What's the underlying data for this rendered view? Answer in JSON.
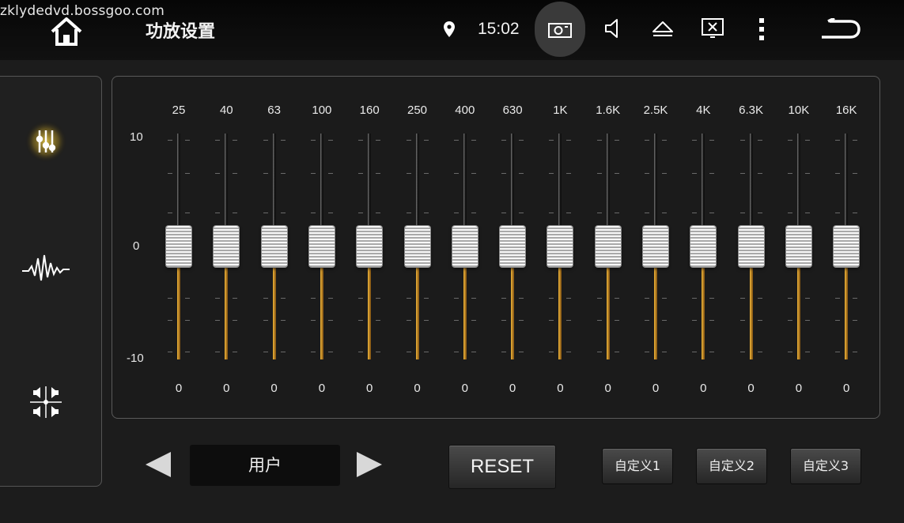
{
  "watermark": "zklydedvd.bossgoo.com",
  "header": {
    "title": "功放设置",
    "time": "15:02",
    "icons": [
      "home-icon",
      "gps-pin-icon",
      "camera-icon",
      "volume-icon",
      "eject-icon",
      "screen-off-icon",
      "more-vert-icon",
      "back-icon"
    ]
  },
  "sidebar": {
    "items": [
      {
        "name": "equalizer",
        "icon": "equalizer-sliders-icon",
        "active": true
      },
      {
        "name": "sound-effect",
        "icon": "waveform-icon",
        "active": false
      },
      {
        "name": "balance",
        "icon": "speaker-balance-icon",
        "active": false
      }
    ]
  },
  "equalizer": {
    "scale": {
      "max": "10",
      "mid": "0",
      "min": "-10"
    },
    "bands": [
      {
        "freq": "25",
        "gain": "0"
      },
      {
        "freq": "40",
        "gain": "0"
      },
      {
        "freq": "63",
        "gain": "0"
      },
      {
        "freq": "100",
        "gain": "0"
      },
      {
        "freq": "160",
        "gain": "0"
      },
      {
        "freq": "250",
        "gain": "0"
      },
      {
        "freq": "400",
        "gain": "0"
      },
      {
        "freq": "630",
        "gain": "0"
      },
      {
        "freq": "1K",
        "gain": "0"
      },
      {
        "freq": "1.6K",
        "gain": "0"
      },
      {
        "freq": "2.5K",
        "gain": "0"
      },
      {
        "freq": "4K",
        "gain": "0"
      },
      {
        "freq": "6.3K",
        "gain": "0"
      },
      {
        "freq": "10K",
        "gain": "0"
      },
      {
        "freq": "16K",
        "gain": "0"
      }
    ]
  },
  "controls": {
    "preset": "用户",
    "reset_label": "RESET",
    "custom_buttons": [
      "自定义1",
      "自定义2",
      "自定义3"
    ]
  },
  "colors": {
    "accent_glow": "#f2d34a",
    "slider_fill": "#e3a12e"
  }
}
